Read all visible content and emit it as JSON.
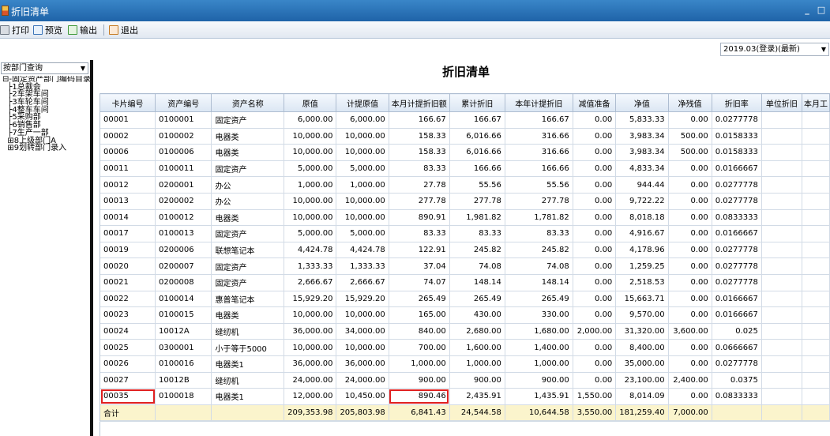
{
  "window": {
    "title": "折旧清单",
    "min_symbol": "_",
    "max_symbol": "□"
  },
  "toolbar": {
    "print": "打印",
    "preview": "预览",
    "export": "输出",
    "exit": "退出"
  },
  "period": {
    "value": "2019.03(登录)(最新)"
  },
  "left_panel": {
    "query_label": "按部门查询",
    "tree": [
      {
        "prefix": "⊟-",
        "label": "固定资产部门编码目录"
      },
      {
        "prefix": "  ├1",
        "label": "总裁会"
      },
      {
        "prefix": "  ├2",
        "label": "车架车间"
      },
      {
        "prefix": "  ├3",
        "label": "车轮车间"
      },
      {
        "prefix": "  ├4",
        "label": "整车车间"
      },
      {
        "prefix": "  ├5",
        "label": "采购部"
      },
      {
        "prefix": "  ├6",
        "label": "销售部"
      },
      {
        "prefix": "  ├7",
        "label": "生产一部"
      },
      {
        "prefix": "  ⊞8",
        "label": "上级部门A"
      },
      {
        "prefix": "  ⊞9",
        "label": "划转部门录入"
      }
    ]
  },
  "report": {
    "title": "折旧清单"
  },
  "table": {
    "headers": [
      "卡片编号",
      "资产编号",
      "资产名称",
      "原值",
      "计提原值",
      "本月计提折旧额",
      "累计折旧",
      "本年计提折旧",
      "减值准备",
      "净值",
      "净残值",
      "折旧率",
      "单位折旧",
      "本月工"
    ],
    "rows": [
      [
        "00001",
        "0100001",
        "固定资产",
        "6,000.00",
        "6,000.00",
        "166.67",
        "166.67",
        "166.67",
        "0.00",
        "5,833.33",
        "0.00",
        "0.0277778",
        "",
        ""
      ],
      [
        "00002",
        "0100002",
        "电器类",
        "10,000.00",
        "10,000.00",
        "158.33",
        "6,016.66",
        "316.66",
        "0.00",
        "3,983.34",
        "500.00",
        "0.0158333",
        "",
        ""
      ],
      [
        "00006",
        "0100006",
        "电器类",
        "10,000.00",
        "10,000.00",
        "158.33",
        "6,016.66",
        "316.66",
        "0.00",
        "3,983.34",
        "500.00",
        "0.0158333",
        "",
        ""
      ],
      [
        "00011",
        "0100011",
        "固定资产",
        "5,000.00",
        "5,000.00",
        "83.33",
        "166.66",
        "166.66",
        "0.00",
        "4,833.34",
        "0.00",
        "0.0166667",
        "",
        ""
      ],
      [
        "00012",
        "0200001",
        "办公",
        "1,000.00",
        "1,000.00",
        "27.78",
        "55.56",
        "55.56",
        "0.00",
        "944.44",
        "0.00",
        "0.0277778",
        "",
        ""
      ],
      [
        "00013",
        "0200002",
        "办公",
        "10,000.00",
        "10,000.00",
        "277.78",
        "277.78",
        "277.78",
        "0.00",
        "9,722.22",
        "0.00",
        "0.0277778",
        "",
        ""
      ],
      [
        "00014",
        "0100012",
        "电器类",
        "10,000.00",
        "10,000.00",
        "890.91",
        "1,981.82",
        "1,781.82",
        "0.00",
        "8,018.18",
        "0.00",
        "0.0833333",
        "",
        ""
      ],
      [
        "00017",
        "0100013",
        "固定资产",
        "5,000.00",
        "5,000.00",
        "83.33",
        "83.33",
        "83.33",
        "0.00",
        "4,916.67",
        "0.00",
        "0.0166667",
        "",
        ""
      ],
      [
        "00019",
        "0200006",
        "联想笔记本",
        "4,424.78",
        "4,424.78",
        "122.91",
        "245.82",
        "245.82",
        "0.00",
        "4,178.96",
        "0.00",
        "0.0277778",
        "",
        ""
      ],
      [
        "00020",
        "0200007",
        "固定资产",
        "1,333.33",
        "1,333.33",
        "37.04",
        "74.08",
        "74.08",
        "0.00",
        "1,259.25",
        "0.00",
        "0.0277778",
        "",
        ""
      ],
      [
        "00021",
        "0200008",
        "固定资产",
        "2,666.67",
        "2,666.67",
        "74.07",
        "148.14",
        "148.14",
        "0.00",
        "2,518.53",
        "0.00",
        "0.0277778",
        "",
        ""
      ],
      [
        "00022",
        "0100014",
        "惠普笔记本",
        "15,929.20",
        "15,929.20",
        "265.49",
        "265.49",
        "265.49",
        "0.00",
        "15,663.71",
        "0.00",
        "0.0166667",
        "",
        ""
      ],
      [
        "00023",
        "0100015",
        "电器类",
        "10,000.00",
        "10,000.00",
        "165.00",
        "430.00",
        "330.00",
        "0.00",
        "9,570.00",
        "0.00",
        "0.0166667",
        "",
        ""
      ],
      [
        "00024",
        "10012A",
        "缝纫机",
        "36,000.00",
        "34,000.00",
        "840.00",
        "2,680.00",
        "1,680.00",
        "2,000.00",
        "31,320.00",
        "3,600.00",
        "0.025",
        "",
        ""
      ],
      [
        "00025",
        "0300001",
        "小于等于5000",
        "10,000.00",
        "10,000.00",
        "700.00",
        "1,600.00",
        "1,400.00",
        "0.00",
        "8,400.00",
        "0.00",
        "0.0666667",
        "",
        ""
      ],
      [
        "00026",
        "0100016",
        "电器类1",
        "36,000.00",
        "36,000.00",
        "1,000.00",
        "1,000.00",
        "1,000.00",
        "0.00",
        "35,000.00",
        "0.00",
        "0.0277778",
        "",
        ""
      ],
      [
        "00027",
        "10012B",
        "缝纫机",
        "24,000.00",
        "24,000.00",
        "900.00",
        "900.00",
        "900.00",
        "0.00",
        "23,100.00",
        "2,400.00",
        "0.0375",
        "",
        ""
      ],
      [
        "00035",
        "0100018",
        "电器类1",
        "12,000.00",
        "10,450.00",
        "890.46",
        "2,435.91",
        "1,435.91",
        "1,550.00",
        "8,014.09",
        "0.00",
        "0.0833333",
        "",
        ""
      ]
    ],
    "total": [
      "合计",
      "",
      "",
      "209,353.98",
      "205,803.98",
      "6,841.43",
      "24,544.58",
      "10,644.58",
      "3,550.00",
      "181,259.40",
      "7,000.00",
      "",
      "",
      ""
    ],
    "highlighted_cells": [
      {
        "row": 17,
        "col": 0
      },
      {
        "row": 17,
        "col": 5
      }
    ]
  }
}
